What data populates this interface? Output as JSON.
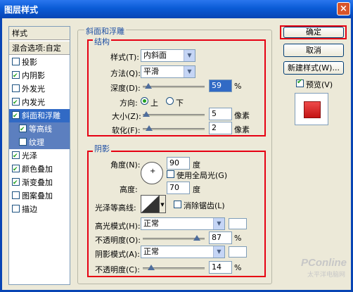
{
  "window": {
    "title": "图层样式",
    "close_glyph": "×"
  },
  "left_list": {
    "header": "样式",
    "blend": "混合选项:自定",
    "items": [
      {
        "label": "投影",
        "checked": false
      },
      {
        "label": "内阴影",
        "checked": true
      },
      {
        "label": "外发光",
        "checked": false
      },
      {
        "label": "内发光",
        "checked": true
      },
      {
        "label": "斜面和浮雕",
        "checked": true
      },
      {
        "label": "等高线",
        "checked": true
      },
      {
        "label": "纹理",
        "checked": false
      },
      {
        "label": "光泽",
        "checked": true
      },
      {
        "label": "颜色叠加",
        "checked": true
      },
      {
        "label": "渐变叠加",
        "checked": true
      },
      {
        "label": "图案叠加",
        "checked": false
      },
      {
        "label": "描边",
        "checked": false
      }
    ]
  },
  "bevel": {
    "group_title": "斜面和浮雕",
    "structure_title": "结构",
    "style_label": "样式(T):",
    "style_value": "内斜面",
    "technique_label": "方法(Q):",
    "technique_value": "平滑",
    "depth_label": "深度(D):",
    "depth_value": "59",
    "depth_unit": "%",
    "direction_label": "方向:",
    "dir_up": "上",
    "dir_down": "下",
    "size_label": "大小(Z):",
    "size_value": "5",
    "size_unit": "像素",
    "soften_label": "软化(F):",
    "soften_value": "2",
    "soften_unit": "像素"
  },
  "shading": {
    "title": "阴影",
    "angle_label": "角度(N):",
    "angle_value": "90",
    "angle_unit": "度",
    "global_light": "使用全局光(G)",
    "altitude_label": "高度:",
    "altitude_value": "70",
    "altitude_unit": "度",
    "gloss_label": "光泽等高线:",
    "anti_alias": "消除锯齿(L)",
    "highlight_mode_label": "高光模式(H):",
    "highlight_mode": "正常",
    "opacity1_label": "不透明度(O):",
    "opacity1_value": "87",
    "shadow_mode_label": "阴影模式(A):",
    "shadow_mode": "正常",
    "opacity2_label": "不透明度(C):",
    "opacity2_value": "14",
    "pct": "%"
  },
  "right": {
    "ok": "确定",
    "cancel": "取消",
    "new_style": "新建样式(W)...",
    "preview": "预览(V)"
  },
  "colors": {
    "highlight": "#e60012",
    "preview": "#d81e1e"
  },
  "watermark": {
    "brand": "PConline",
    "sub": "太平洋电脑网"
  }
}
